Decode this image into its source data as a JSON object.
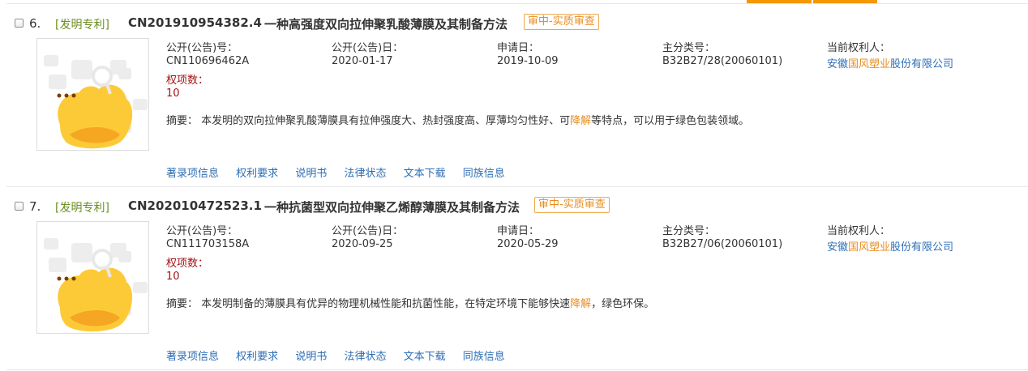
{
  "records": [
    {
      "index": "6.",
      "type": "[发明专利]",
      "application_number": "CN201910954382.4",
      "title": "一种高强度双向拉伸聚乳酸薄膜及其制备方法",
      "status": "审中-实质审查",
      "pub_no_label": "公开(公告)号：",
      "pub_no": "CN110696462A",
      "pub_date_label": "公开(公告)日：",
      "pub_date": "2020-01-17",
      "app_date_label": "申请日：",
      "app_date": "2019-10-09",
      "ipc_label": "主分类号：",
      "ipc": "B32B27/28(20060101)",
      "owner_label": "当前权利人：",
      "owner_pre": "安徽",
      "owner_hl": "国风塑业",
      "owner_post": "股份有限公司",
      "claims_label": "权项数：",
      "claims": "10",
      "abstract_pre": "摘要： 本发明的双向拉伸聚乳酸薄膜具有拉伸强度大、热封强度高、厚薄均匀性好、可",
      "abstract_hl": "降解",
      "abstract_post": "等特点，可以用于绿色包装领域。",
      "links": [
        "著录项信息",
        "权利要求",
        "说明书",
        "法律状态",
        "文本下载",
        "同族信息"
      ]
    },
    {
      "index": "7.",
      "type": "[发明专利]",
      "application_number": "CN202010472523.1",
      "title": "一种抗菌型双向拉伸聚乙烯醇薄膜及其制备方法",
      "status": "审中-实质审查",
      "pub_no_label": "公开(公告)号：",
      "pub_no": "CN111703158A",
      "pub_date_label": "公开(公告)日：",
      "pub_date": "2020-09-25",
      "app_date_label": "申请日：",
      "app_date": "2020-05-29",
      "ipc_label": "主分类号：",
      "ipc": "B32B27/06(20060101)",
      "owner_label": "当前权利人：",
      "owner_pre": "安徽",
      "owner_hl": "国风塑业",
      "owner_post": "股份有限公司",
      "claims_label": "权项数：",
      "claims": "10",
      "abstract_pre": "摘要： 本发明制备的薄膜具有优异的物理机械性能和抗菌性能，在特定环境下能够快速",
      "abstract_hl": "降解",
      "abstract_post": "，绿色环保。",
      "links": [
        "著录项信息",
        "权利要求",
        "说明书",
        "法律状态",
        "文本下载",
        "同族信息"
      ]
    }
  ],
  "colors": {
    "accent": "#f39800",
    "link": "#2e6eb5",
    "type": "#6b8e23",
    "status": "#e88d1f",
    "claims": "#a51212"
  },
  "icons": [
    "checkbox-icon",
    "patent-thumbnail-mascot-icon"
  ]
}
